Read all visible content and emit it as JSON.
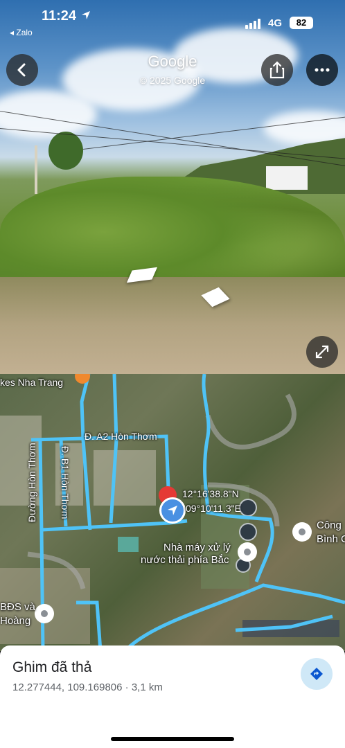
{
  "status_bar": {
    "time": "11:24",
    "back_app": "◂ Zalo",
    "network": "4G",
    "battery": "82"
  },
  "street_view": {
    "logo": "Google",
    "copyright": "© 2025 Google"
  },
  "icons": {
    "back": "chevron-left-icon",
    "share": "share-icon",
    "more": "more-icon",
    "expand": "expand-icon",
    "directions": "directions-icon",
    "location": "location-arrow-icon"
  },
  "map": {
    "labels": {
      "poi_top": "kes Nha Trang",
      "road_a2": "Đ. A2 Hòn Thơm",
      "road_b1": "Đ. B1 Hòn Thơm",
      "road_hon_thom": "Đường Hòn Thơm",
      "coord_lat": "12°16'38.8\"N",
      "coord_lng": "09°10'11.3\"E",
      "plant_line1": "Nhà máy xử lý",
      "plant_line2": "nước thải phía Bắc",
      "right_line1": "Công",
      "right_line2": "Bình C",
      "left_line1": "BĐS và",
      "left_line2": "Hoàng"
    }
  },
  "place_sheet": {
    "title": "Ghim đã thả",
    "subtitle": "12.277444, 109.169806 · 3,1 km"
  },
  "colors": {
    "route": "#4fc3f7",
    "pin": "#e53935",
    "location": "#4a90e2"
  }
}
